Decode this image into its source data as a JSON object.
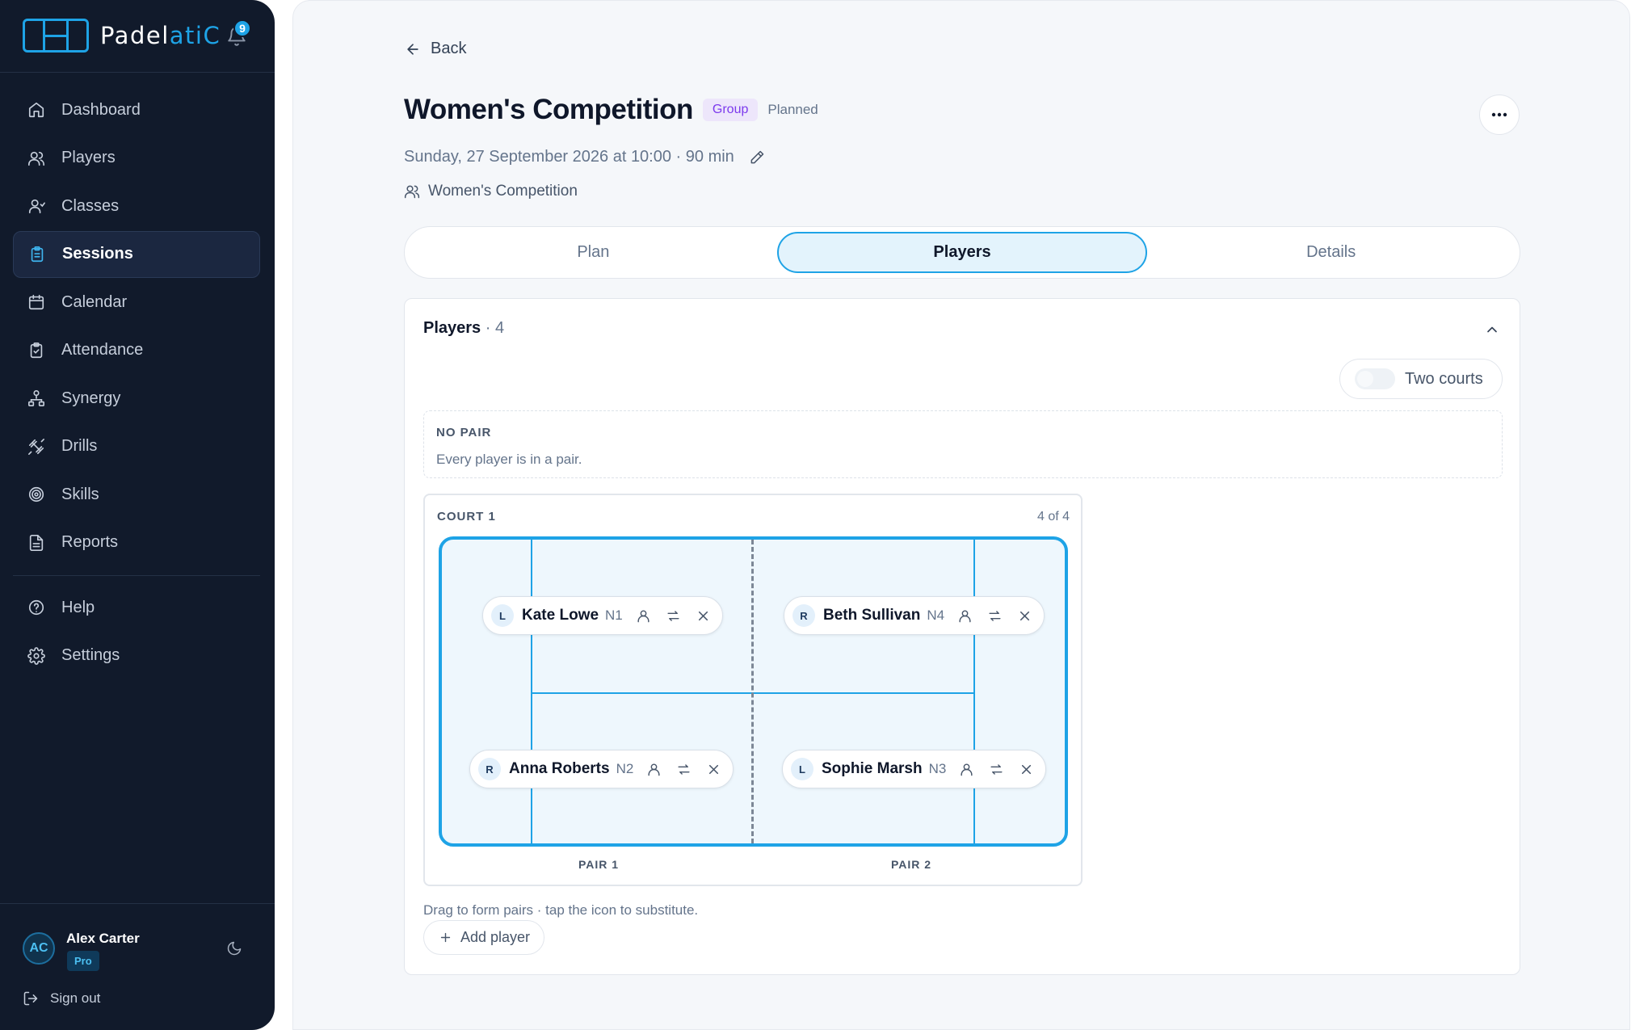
{
  "brand": {
    "name_a": "Padel",
    "name_b": "atiC",
    "notifications": "9"
  },
  "sidebar": {
    "items": [
      {
        "label": "Dashboard",
        "icon": "home-icon"
      },
      {
        "label": "Players",
        "icon": "users-icon"
      },
      {
        "label": "Classes",
        "icon": "user-group-icon"
      },
      {
        "label": "Sessions",
        "icon": "clipboard-icon",
        "active": true
      },
      {
        "label": "Calendar",
        "icon": "calendar-icon"
      },
      {
        "label": "Attendance",
        "icon": "clipboard-check-icon"
      },
      {
        "label": "Synergy",
        "icon": "network-icon"
      },
      {
        "label": "Drills",
        "icon": "dumbbell-icon"
      },
      {
        "label": "Skills",
        "icon": "target-icon"
      },
      {
        "label": "Reports",
        "icon": "document-icon"
      }
    ],
    "bottom_items": [
      {
        "label": "Help",
        "icon": "help-icon"
      },
      {
        "label": "Settings",
        "icon": "gear-icon"
      }
    ],
    "user": {
      "initials": "AC",
      "name": "Alex Carter",
      "plan": "Pro"
    },
    "signout": "Sign out"
  },
  "page": {
    "back": "Back",
    "title": "Women's Competition",
    "badge_type": "Group",
    "status": "Planned",
    "datetime": "Sunday, 27 September 2026 at 10:00 · 90 min",
    "group": "Women's Competition",
    "tabs": [
      {
        "label": "Plan"
      },
      {
        "label": "Players",
        "active": true
      },
      {
        "label": "Details"
      }
    ]
  },
  "players_card": {
    "title": "Players",
    "count": "· 4",
    "two_courts": "Two courts",
    "no_pair_title": "NO PAIR",
    "no_pair_text": "Every player is in a pair.",
    "court": {
      "label": "COURT 1",
      "count": "4 of 4",
      "pairs": [
        "PAIR 1",
        "PAIR 2"
      ],
      "players": [
        {
          "side": "L",
          "name": "Kate Lowe",
          "level": "N1"
        },
        {
          "side": "R",
          "name": "Beth Sullivan",
          "level": "N4"
        },
        {
          "side": "R",
          "name": "Anna Roberts",
          "level": "N2"
        },
        {
          "side": "L",
          "name": "Sophie Marsh",
          "level": "N3"
        }
      ]
    },
    "hint": "Drag to form pairs · tap the icon to substitute.",
    "add_player": "Add player"
  },
  "colors": {
    "accent": "#1ea3e6",
    "sidebar_bg": "#111a2b",
    "group_badge": "#7c3aed"
  }
}
